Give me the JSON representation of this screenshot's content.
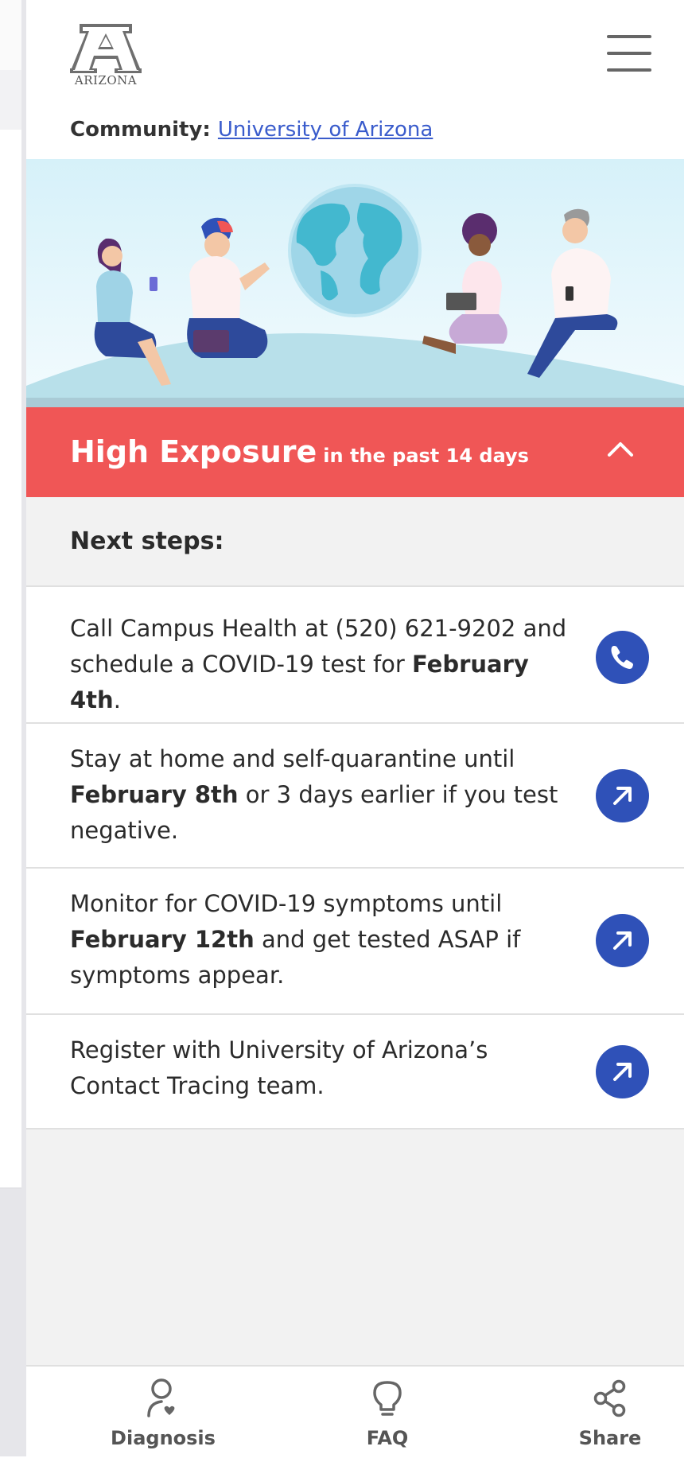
{
  "header": {
    "logo_text": "ARIZONA",
    "menu_icon": "hamburger-menu-icon",
    "community_label": "Community:",
    "community_link": "University of Arizona"
  },
  "exposure": {
    "title": "High Exposure",
    "subtitle": "in the past 14 days",
    "color": "#f05656",
    "toggle_icon": "chevron-up-icon"
  },
  "next_steps": {
    "heading": "Next steps:",
    "items": [
      {
        "pre": "Call Campus Health at (520) 621-9202 and schedule a COVID-19 test for ",
        "bold": "February 4th",
        "post": ".",
        "icon": "phone-icon"
      },
      {
        "pre": "Stay at home and self-quarantine until ",
        "bold": "February 8th",
        "post": " or 3 days earlier if you test negative.",
        "icon": "arrow-up-right-icon"
      },
      {
        "pre": "Monitor for COVID-19 symptoms until ",
        "bold": "February 12th",
        "post": " and get tested ASAP if symptoms appear.",
        "icon": "arrow-up-right-icon"
      },
      {
        "pre": "Register with University of Arizona’s Contact Tracing team.",
        "bold": "",
        "post": "",
        "icon": "arrow-up-right-icon"
      }
    ]
  },
  "bottom_nav": {
    "items": [
      {
        "label": "Diagnosis",
        "icon": "person-heart-icon"
      },
      {
        "label": "FAQ",
        "icon": "lightbulb-icon"
      },
      {
        "label": "Share",
        "icon": "share-icon"
      }
    ]
  },
  "colors": {
    "accent_blue": "#2f51b8",
    "link_blue": "#3a5ccc",
    "exposure_red": "#f05656"
  }
}
